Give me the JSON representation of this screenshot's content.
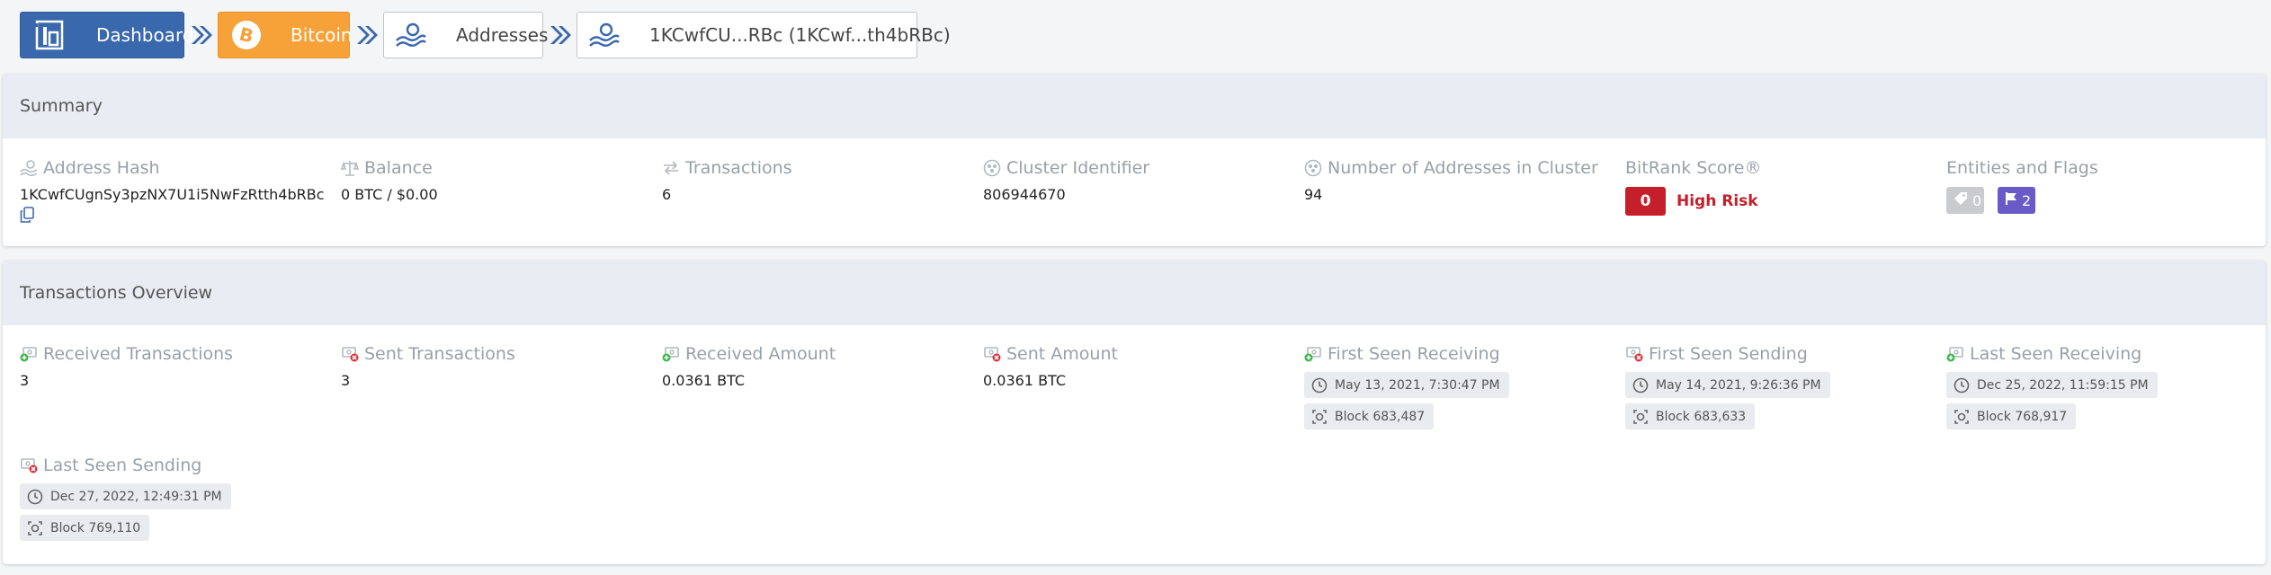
{
  "breadcrumb": {
    "dashboard": "Dashboard",
    "bitcoin": "Bitcoin",
    "addresses": "Addresses",
    "address": "1KCwfCU...RBc (1KCwf...th4bRBc)"
  },
  "summary": {
    "title": "Summary",
    "address_hash": {
      "label": "Address Hash",
      "value": "1KCwfCUgnSy3pzNX7U1i5NwFzRtth4bRBc"
    },
    "balance": {
      "label": "Balance",
      "value": "0 BTC / $0.00"
    },
    "transactions": {
      "label": "Transactions",
      "value": "6"
    },
    "cluster_identifier": {
      "label": "Cluster Identifier",
      "value": "806944670"
    },
    "addresses_in_cluster": {
      "label": "Number of Addresses in Cluster",
      "value": "94"
    },
    "bitrank": {
      "label": "BitRank Score®",
      "score": "0",
      "risk": "High Risk"
    },
    "entities_flags": {
      "label": "Entities and Flags",
      "entities_count": "0",
      "flags_count": "2"
    }
  },
  "overview": {
    "title": "Transactions Overview",
    "received_transactions": {
      "label": "Received Transactions",
      "value": "3"
    },
    "sent_transactions": {
      "label": "Sent Transactions",
      "value": "3"
    },
    "received_amount": {
      "label": "Received Amount",
      "value": "0.0361 BTC"
    },
    "sent_amount": {
      "label": "Sent Amount",
      "value": "0.0361 BTC"
    },
    "first_seen_receiving": {
      "label": "First Seen Receiving",
      "time": "May 13, 2021, 7:30:47 PM",
      "block": "Block 683,487"
    },
    "first_seen_sending": {
      "label": "First Seen Sending",
      "time": "May 14, 2021, 9:26:36 PM",
      "block": "Block 683,633"
    },
    "last_seen_receiving": {
      "label": "Last Seen Receiving",
      "time": "Dec 25, 2022, 11:59:15 PM",
      "block": "Block 768,917"
    },
    "last_seen_sending": {
      "label": "Last Seen Sending",
      "time": "Dec 27, 2022, 12:49:31 PM",
      "block": "Block 769,110"
    }
  },
  "colors": {
    "dashboard": "#3a68ad",
    "bitcoin": "#f7a239",
    "risk": "#c41f2a",
    "flags": "#6a5ac7",
    "receive_icon": "#3bb54a",
    "send_icon": "#d9303a"
  },
  "icons": {
    "dashboard": "dashboard-icon",
    "bitcoin": "bitcoin-icon",
    "address": "address-icon",
    "clock": "clock-icon",
    "block": "block-icon",
    "copy": "copy-icon",
    "tag": "tag-icon",
    "flag": "flag-icon"
  }
}
